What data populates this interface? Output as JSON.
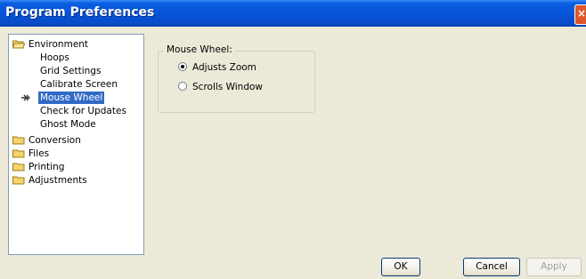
{
  "window": {
    "title": "Program Preferences"
  },
  "tree": {
    "items": [
      {
        "label": "Environment",
        "type": "folder",
        "level": 0,
        "expanded": true
      },
      {
        "label": "Hoops",
        "type": "page",
        "level": 1
      },
      {
        "label": "Grid Settings",
        "type": "page",
        "level": 1
      },
      {
        "label": "Calibrate Screen",
        "type": "page",
        "level": 1
      },
      {
        "label": "Mouse Wheel",
        "type": "page",
        "level": 1,
        "selected": true
      },
      {
        "label": "Check for Updates",
        "type": "page",
        "level": 1
      },
      {
        "label": "Ghost Mode",
        "type": "page",
        "level": 1
      },
      {
        "label": "Conversion",
        "type": "folder",
        "level": 0
      },
      {
        "label": "Files",
        "type": "folder",
        "level": 0
      },
      {
        "label": "Printing",
        "type": "folder",
        "level": 0
      },
      {
        "label": "Adjustments",
        "type": "folder",
        "level": 0
      }
    ]
  },
  "mouse_wheel": {
    "group_label": "Mouse Wheel:",
    "options": [
      {
        "label": "Adjusts Zoom",
        "checked": true
      },
      {
        "label": "Scrolls Window",
        "checked": false
      }
    ]
  },
  "buttons": {
    "ok": "OK",
    "cancel": "Cancel",
    "apply": "Apply"
  },
  "colors": {
    "titlebar": "#0553d6",
    "selection": "#316ac5",
    "face": "#ece9d8"
  },
  "icons": {
    "folder": "folder-icon",
    "open_folder": "open-folder-icon",
    "current": "arrow-right-icon",
    "close": "close-icon"
  }
}
